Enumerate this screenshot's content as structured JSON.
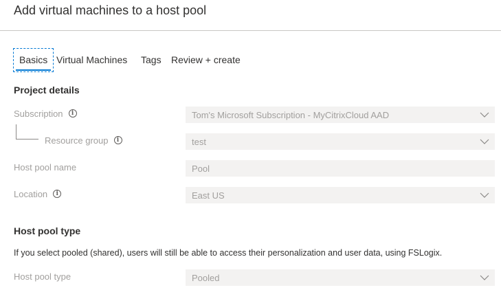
{
  "header": {
    "title": "Add virtual machines to a host pool"
  },
  "tabs": [
    {
      "label": "Basics",
      "active": true
    },
    {
      "label": "Virtual Machines",
      "active": false
    },
    {
      "label": "Tags",
      "active": false
    },
    {
      "label": "Review + create",
      "active": false
    }
  ],
  "project_details": {
    "heading": "Project details",
    "subscription": {
      "label": "Subscription",
      "value": "Tom's Microsoft Subscription - MyCitrixCloud AAD"
    },
    "resource_group": {
      "label": "Resource group",
      "value": "test"
    },
    "host_pool_name": {
      "label": "Host pool name",
      "value": "Pool"
    },
    "location": {
      "label": "Location",
      "value": "East US"
    }
  },
  "host_pool_type_section": {
    "heading": "Host pool type",
    "description": "If you select pooled (shared), users will still be able to access their personalization and user data, using FSLogix.",
    "host_pool_type": {
      "label": "Host pool type",
      "value": "Pooled"
    }
  },
  "icons": {
    "info": "info-icon",
    "dropdown": "chevron-down-icon"
  },
  "colors": {
    "accent": "#0078d4",
    "field_bg": "#f3f2f1",
    "disabled_text": "#a19f9d"
  }
}
